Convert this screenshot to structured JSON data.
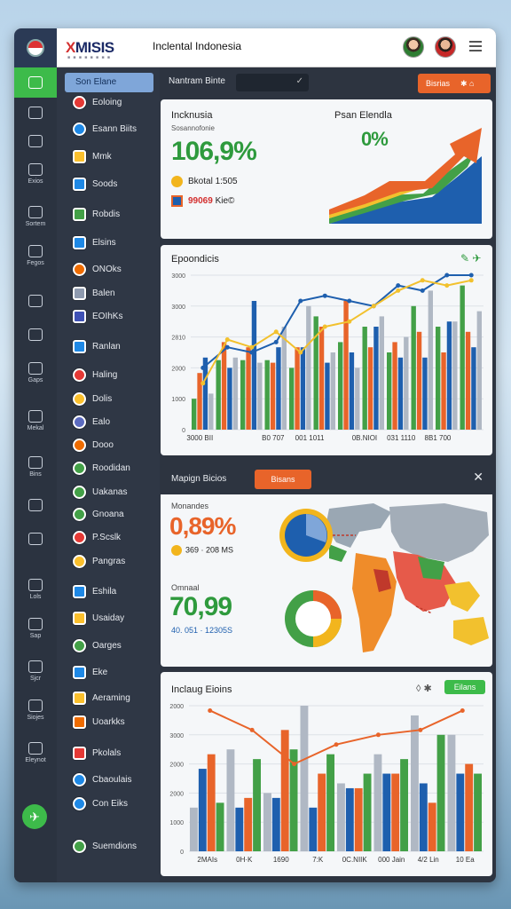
{
  "app": {
    "logo": "MISIS",
    "logo_prefix": "X",
    "logo_sub": "■ ■ ■ ■ ■ ■ ■ ■",
    "title": "Inclental Indonesia"
  },
  "rail": [
    {
      "label": "",
      "icon": "home-icon"
    },
    {
      "label": "",
      "icon": "link-icon"
    },
    {
      "label": "",
      "icon": "group-icon"
    },
    {
      "label": "Exios",
      "icon": "rocket-icon"
    },
    {
      "label": "Sortem",
      "icon": "monitor-icon"
    },
    {
      "label": "Fegos",
      "icon": "search-icon"
    },
    {
      "label": "",
      "icon": "leaf-icon"
    },
    {
      "label": "",
      "icon": "chart-icon"
    },
    {
      "label": "Gaps",
      "icon": "tools-icon"
    },
    {
      "label": "Mekal",
      "icon": "inbox-icon"
    },
    {
      "label": "Bins",
      "icon": "lock-icon"
    },
    {
      "label": "",
      "icon": "note-icon"
    },
    {
      "label": "",
      "icon": "pin-icon"
    },
    {
      "label": "Lols",
      "icon": "box-icon"
    },
    {
      "label": "Sap",
      "icon": "folder-icon"
    },
    {
      "label": "Sjcr",
      "icon": "store-icon"
    },
    {
      "label": "Siojes",
      "icon": "share-icon"
    },
    {
      "label": "Eleynot",
      "icon": "edit-icon"
    }
  ],
  "sidebar": {
    "header": "Son Elane",
    "items": [
      {
        "label": "Eoloing",
        "color": "#e53935",
        "icon": "circle"
      },
      {
        "label": "Esann Biits",
        "color": "#1e88e5",
        "icon": "circle"
      },
      {
        "label": "Mmk",
        "color": "#fbc02d",
        "icon": "square"
      },
      {
        "label": "Soods",
        "color": "#1e88e5",
        "icon": "square"
      },
      {
        "label": "Robdis",
        "color": "#43a047",
        "icon": "square"
      },
      {
        "label": "Elsins",
        "color": "#1e88e5",
        "icon": "square"
      },
      {
        "label": "ONOks",
        "color": "#ef6c00",
        "icon": "circle"
      },
      {
        "label": "Balen",
        "color": "#8e9aaf",
        "icon": "square"
      },
      {
        "label": "EOIhKs",
        "color": "#3f51b5",
        "icon": "square"
      },
      {
        "label": "Ranlan",
        "color": "#1e88e5",
        "icon": "square"
      },
      {
        "label": "Haling",
        "color": "#e53935",
        "icon": "circle"
      },
      {
        "label": "Dolis",
        "color": "#fbc02d",
        "icon": "circle"
      },
      {
        "label": "Ealo",
        "color": "#5c6bc0",
        "icon": "circle"
      },
      {
        "label": "Dooo",
        "color": "#ef6c00",
        "icon": "circle"
      },
      {
        "label": "Roodidan",
        "color": "#43a047",
        "icon": "circle"
      },
      {
        "label": "Uakanas",
        "color": "#43a047",
        "icon": "circle"
      },
      {
        "label": "Gnoana",
        "color": "#43a047",
        "icon": "circle"
      },
      {
        "label": "P.Scslk",
        "color": "#e53935",
        "icon": "circle"
      },
      {
        "label": "Pangras",
        "color": "#fbc02d",
        "icon": "circle"
      },
      {
        "label": "Eshila",
        "color": "#1e88e5",
        "icon": "square"
      },
      {
        "label": "Usaiday",
        "color": "#fbc02d",
        "icon": "square"
      },
      {
        "label": "Oarges",
        "color": "#43a047",
        "icon": "circle"
      },
      {
        "label": "Eke",
        "color": "#1e88e5",
        "icon": "square"
      },
      {
        "label": "Aeraming",
        "color": "#fbc02d",
        "icon": "square"
      },
      {
        "label": "Uoarkks",
        "color": "#ef6c00",
        "icon": "square"
      },
      {
        "label": "Pkolals",
        "color": "#e53935",
        "icon": "square"
      },
      {
        "label": "Cbaoulais",
        "color": "#1e88e5",
        "icon": "circle"
      },
      {
        "label": "Con Eiks",
        "color": "#1e88e5",
        "icon": "circle"
      },
      {
        "label": "Suemdions",
        "color": "#43a047",
        "icon": "circle"
      }
    ]
  },
  "topbar": {
    "label": "Nantram Binte",
    "select_value": "",
    "button": "Bisrias"
  },
  "card1": {
    "title": "Incknusia",
    "subtitle": "Sosannofonie",
    "value": "106,9%",
    "stat1": "Bkotal 1:505",
    "stat2": "99069",
    "stat2_suffix": "Kie©",
    "right_title": "Psan Elendla",
    "right_value": "0%"
  },
  "card2": {
    "title": "Epoondicis"
  },
  "card3": {
    "title": "Mapign Bicios",
    "tab": "Bisans",
    "label1": "Monandes",
    "value1": "0,89%",
    "stat1": "369 · 208 MS",
    "label2": "Omnaal",
    "value2": "70,99",
    "stat2": "40. 051 · 12305S"
  },
  "card4": {
    "title": "Inclaug Eioins",
    "button": "Eilans"
  },
  "chart_data": [
    {
      "type": "bar",
      "title": "Epoondicis",
      "categories": [
        "3000 BII",
        "",
        "",
        "",
        "B0 707",
        "",
        "001 1011",
        "",
        "",
        "0B.NIOI",
        "",
        "031 1110",
        "",
        "8B1 700",
        "",
        ""
      ],
      "y_ticks": [
        "0",
        "1000",
        "2000",
        "2810",
        "3000",
        "3000"
      ],
      "ylim": [
        0,
        3000
      ],
      "series": [
        {
          "color": "#43a047",
          "values": [
            600,
            1350,
            1350,
            1350,
            1200,
            2200,
            1700,
            2000,
            1500,
            2400,
            2000,
            2800
          ]
        },
        {
          "color": "#e8642a",
          "values": [
            1100,
            1700,
            1600,
            1300,
            1600,
            2000,
            2500,
            1600,
            1700,
            1900,
            1500,
            1900
          ]
        },
        {
          "color": "#1e5fae",
          "values": [
            1400,
            1200,
            2500,
            1600,
            1600,
            1300,
            1500,
            2000,
            1400,
            1400,
            2100,
            1600
          ]
        },
        {
          "color": "#b0b8c4",
          "values": [
            700,
            1400,
            1300,
            2000,
            2400,
            1500,
            1200,
            2200,
            1800,
            2700,
            2100,
            2300
          ]
        }
      ],
      "lines": [
        {
          "color": "#1e5fae",
          "values": [
            1200,
            1600,
            1500,
            1700,
            2500,
            2600,
            2500,
            2400,
            2800,
            2700,
            3000,
            3100
          ]
        },
        {
          "color": "#f2c12e",
          "values": [
            900,
            1750,
            1600,
            1900,
            1500,
            2000,
            2100,
            2400,
            2700,
            2900,
            2800,
            2900
          ]
        }
      ]
    },
    {
      "type": "bar",
      "title": "Inclaug Eioins",
      "categories": [
        "2MAIs",
        "0H·K",
        "1690",
        "7:K",
        "0C.NIIK",
        "000 Jain",
        "4/2 Lin",
        "10 Ea"
      ],
      "y_ticks": [
        "0",
        "1000",
        "2000",
        "2000",
        "3000",
        "2000"
      ],
      "ylim": [
        0,
        3000
      ],
      "series": [
        {
          "color": "#b0b8c4",
          "values": [
            900,
            2100,
            1200,
            3000,
            1400,
            2000,
            2800,
            2400
          ]
        },
        {
          "color": "#1e5fae",
          "values": [
            1700,
            900,
            1100,
            900,
            1300,
            1600,
            1400,
            1600
          ]
        },
        {
          "color": "#e8642a",
          "values": [
            2000,
            1100,
            2500,
            1600,
            1300,
            1600,
            1000,
            1800
          ]
        },
        {
          "color": "#43a047",
          "values": [
            1000,
            1900,
            2100,
            2000,
            1600,
            1900,
            2400,
            1600
          ]
        }
      ],
      "lines": [
        {
          "color": "#e8642a",
          "values": [
            2900,
            2500,
            1800,
            2200,
            2400,
            2500,
            2900
          ]
        }
      ]
    }
  ]
}
